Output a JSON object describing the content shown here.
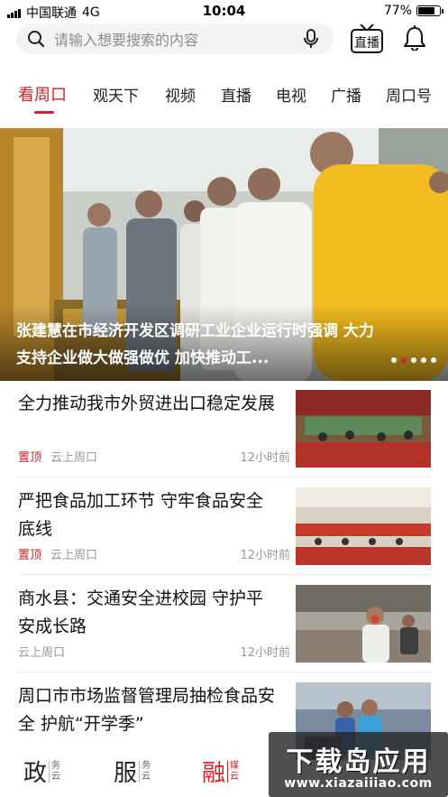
{
  "status_bar": {
    "carrier": "中国联通",
    "network": "4G",
    "time": "10:04",
    "battery": "77%",
    "battery_level": 0.77
  },
  "search": {
    "placeholder": "请输入想要搜索的内容"
  },
  "header": {
    "live_label": "直播"
  },
  "tabs": [
    {
      "label": "看周口",
      "active": true
    },
    {
      "label": "观天下"
    },
    {
      "label": "视频"
    },
    {
      "label": "直播"
    },
    {
      "label": "电视"
    },
    {
      "label": "广播"
    },
    {
      "label": "周口号"
    }
  ],
  "banner": {
    "title": "张建慧在市经济开发区调研工业企业运行时强调 大力支持企业做大做强做优 加快推动工...",
    "slide_count": 5,
    "active_slide": 2
  },
  "news": [
    {
      "title": "全力推动我市外贸进出口稳定发展",
      "pinned": "置顶",
      "source": "云上周口",
      "time": "12小时前"
    },
    {
      "title": "严把食品加工环节 守牢食品安全底线",
      "pinned": "置顶",
      "source": "云上周口",
      "time": "12小时前"
    },
    {
      "title": "商水县：交通安全进校园 守护平安成长路",
      "pinned": "",
      "source": "云上周口",
      "time": "12小时前"
    },
    {
      "title": "周口市市场监督管理局抽检食品安全 护航“开学季”",
      "pinned": "",
      "source": "",
      "time": ""
    }
  ],
  "bottom_nav": [
    {
      "big": "政",
      "small": "务云"
    },
    {
      "big": "服",
      "small": "务云"
    },
    {
      "big": "融",
      "small": "媒云",
      "active": true
    }
  ],
  "watermark": {
    "line1": "下载岛应用",
    "line2": "www.xiazaiiiao.com"
  },
  "colors": {
    "accent": "#d0232b"
  }
}
